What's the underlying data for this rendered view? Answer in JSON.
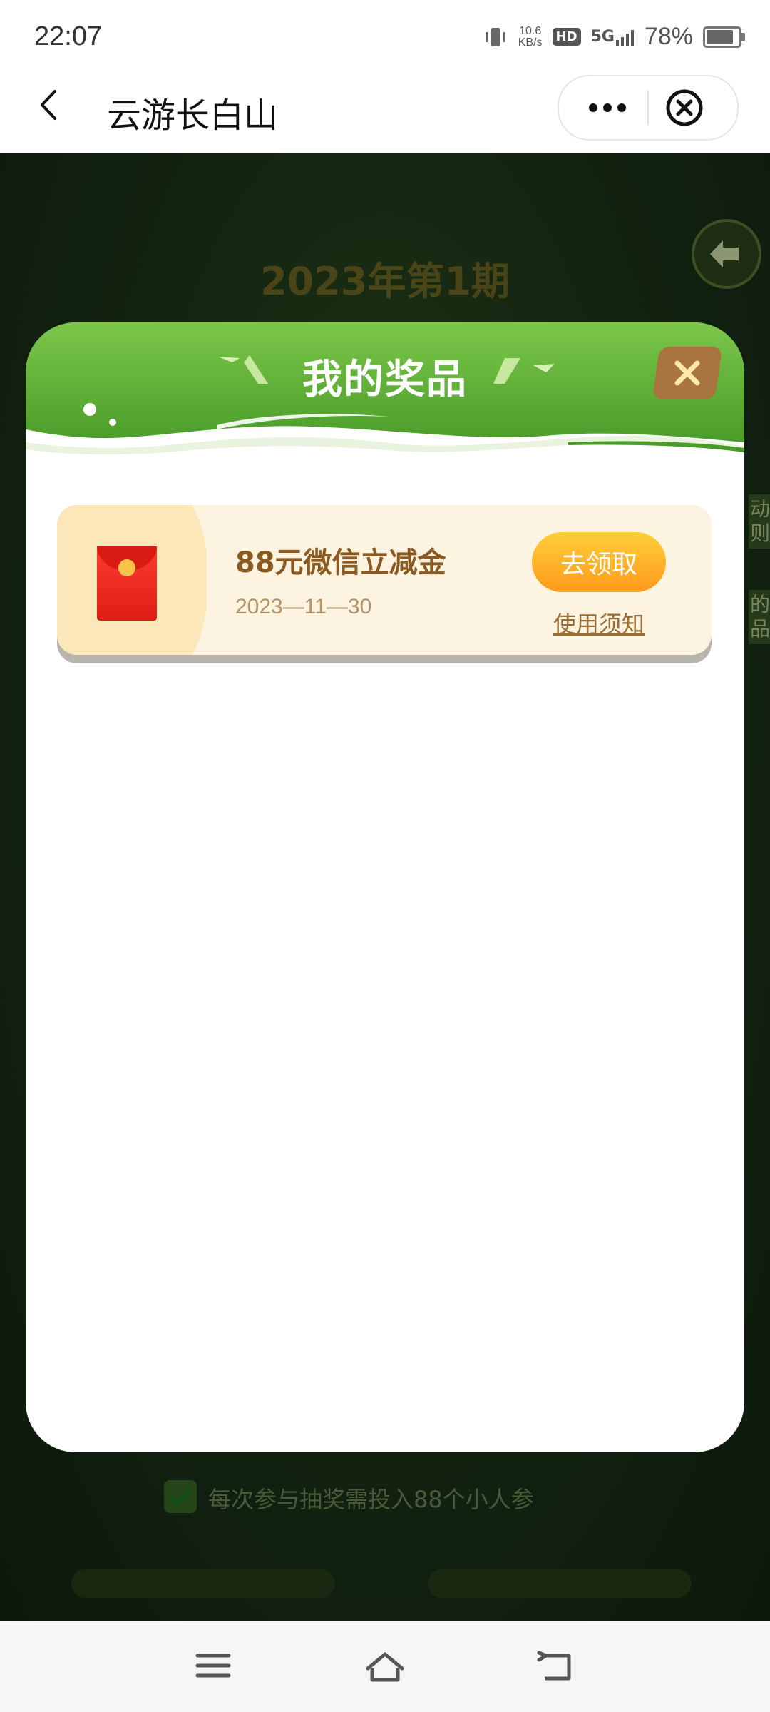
{
  "status_bar": {
    "time": "22:07",
    "net_speed_value": "10.6",
    "net_speed_unit": "KB/s",
    "hd": "HD",
    "signal": "5G",
    "battery": "78%"
  },
  "nav": {
    "title": "云游长白山"
  },
  "background": {
    "banner": "2023年第1期",
    "side_top": "动\n则",
    "side_bottom": "的\n品",
    "footnote": "每次参与抽奖需投入88个小人参"
  },
  "modal": {
    "title": "我的奖品",
    "prizes": [
      {
        "name": "88元微信立减金",
        "date": "2023—11—30",
        "claim_label": "去领取",
        "notice_label": "使用须知"
      }
    ]
  },
  "colors": {
    "header_green": "#6fbf3f",
    "claim_orange": "#ff9a1a",
    "prize_text": "#8a5a22",
    "close_brown": "#a9743f"
  }
}
